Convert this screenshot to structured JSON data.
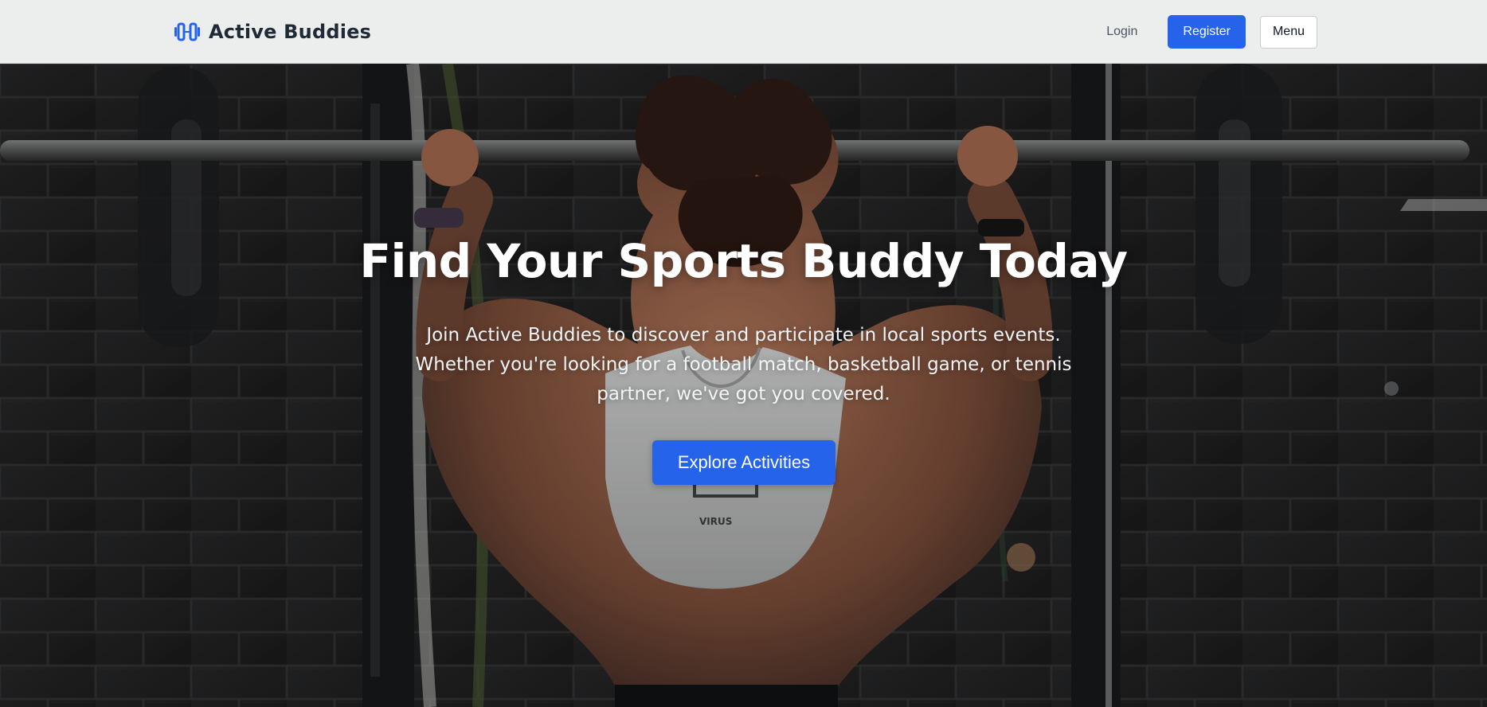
{
  "header": {
    "brand_name": "Active Buddies",
    "brand_icon": "dumbbell-icon",
    "login_label": "Login",
    "register_label": "Register",
    "menu_label": "Menu"
  },
  "hero": {
    "title": "Find Your Sports Buddy Today",
    "description": "Join Active Buddies to discover and participate in local sports events. Whether you're looking for a football match, basketball game, or tennis partner, we've got you covered.",
    "cta_label": "Explore Activities"
  },
  "colors": {
    "accent": "#2563eb",
    "header_background": "#eceded",
    "brand_text": "#1f2a37",
    "hero_text": "#ffffff"
  }
}
